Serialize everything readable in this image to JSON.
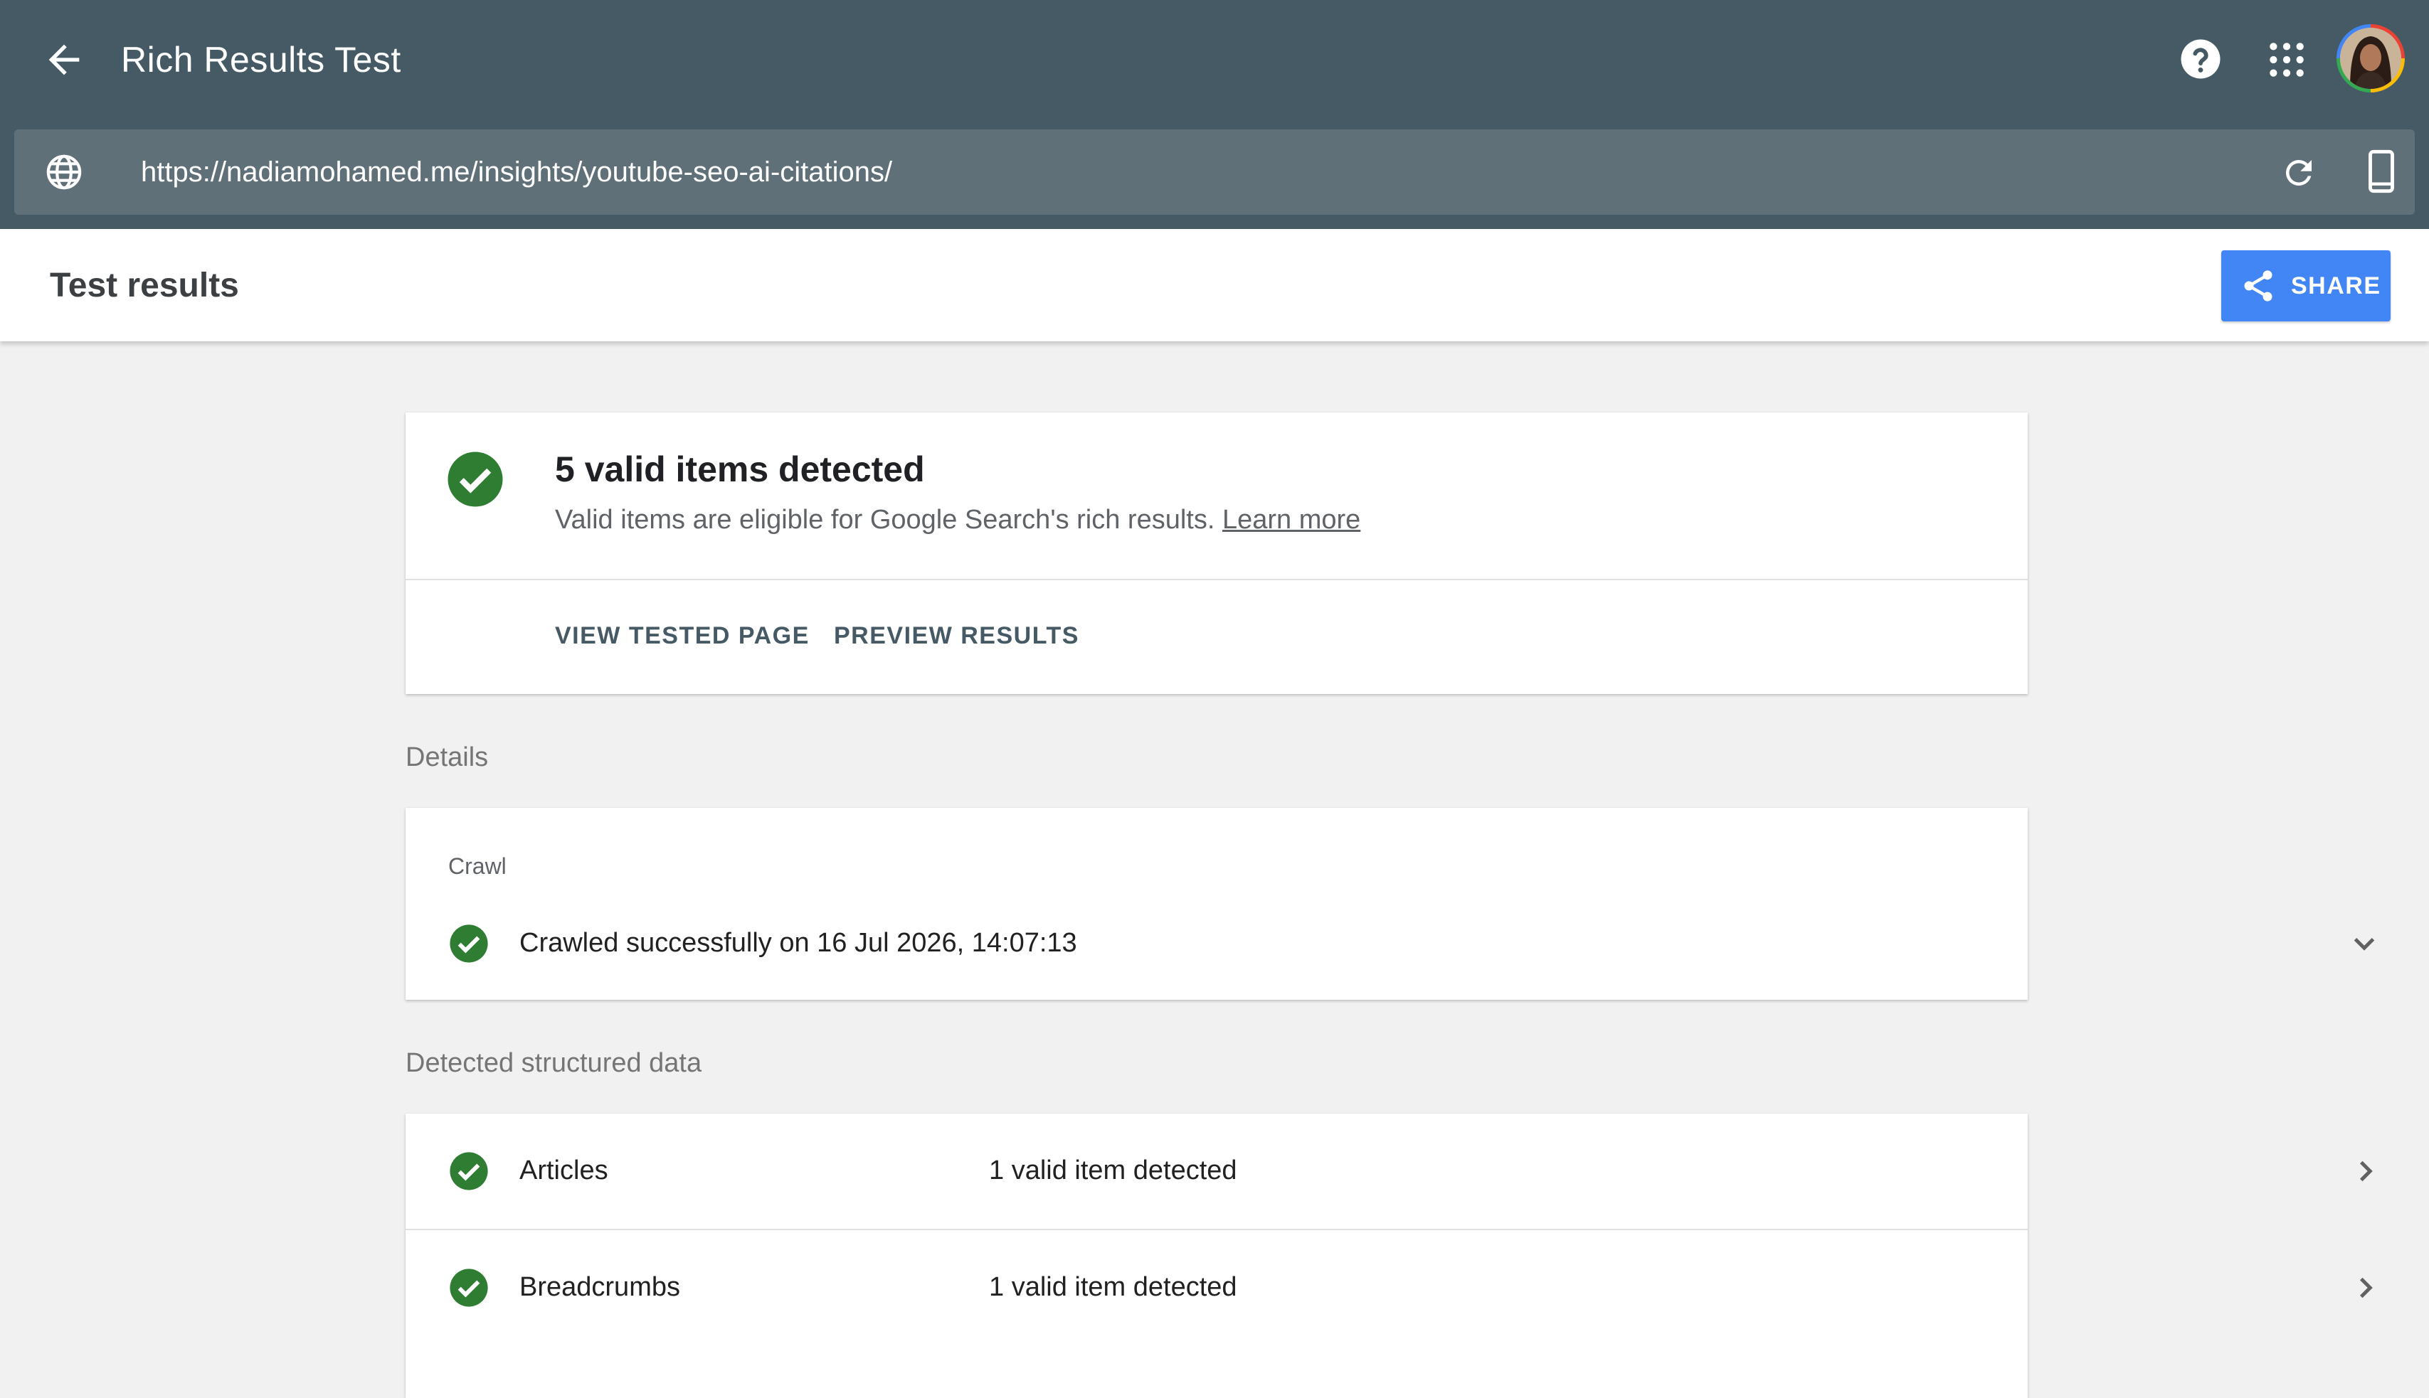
{
  "app": {
    "title": "Rich Results Test",
    "header_color": "#455a64",
    "urlbar_color": "#607079",
    "icons": {
      "back": "arrow-back-icon",
      "help": "help-circle-icon",
      "apps": "apps-grid-icon",
      "globe": "globe-icon",
      "refresh": "refresh-icon",
      "device": "smartphone-icon"
    }
  },
  "url": {
    "value": "https://nadiamohamed.me/insights/youtube-seo-ai-citations/"
  },
  "results_header": {
    "title": "Test results",
    "share_label": "SHARE",
    "share_color": "#4285f4"
  },
  "summary": {
    "title": "5 valid items detected",
    "description": "Valid items are eligible for Google Search's rich results.",
    "learn_more": "Learn more",
    "actions": {
      "view_tested_page": "VIEW TESTED PAGE",
      "preview_results": "PREVIEW RESULTS"
    },
    "status_color": "#2e7d32"
  },
  "details": {
    "section_label": "Details",
    "crawl": {
      "label": "Crawl",
      "status": "Crawled successfully on 16 Jul 2026, 14:07:13"
    }
  },
  "structured_data": {
    "section_label": "Detected structured data",
    "items": [
      {
        "name": "Articles",
        "status": "1 valid item detected"
      },
      {
        "name": "Breadcrumbs",
        "status": "1 valid item detected"
      }
    ]
  }
}
